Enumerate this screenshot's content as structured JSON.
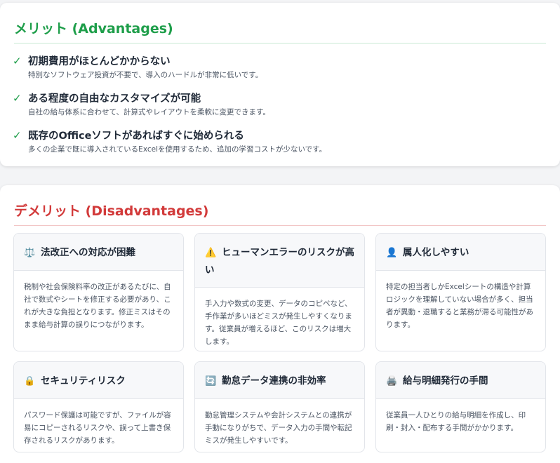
{
  "advantages": {
    "title": "メリット (Advantages)",
    "check_icon": "check-icon",
    "items": [
      {
        "heading": "初期費用がほとんどかからない",
        "desc": "特別なソフトウェア投資が不要で、導入のハードルが非常に低いです。"
      },
      {
        "heading": "ある程度の自由なカスタマイズが可能",
        "desc": "自社の給与体系に合わせて、計算式やレイアウトを柔軟に変更できます。"
      },
      {
        "heading": "既存のOfficeソフトがあればすぐに始められる",
        "desc": "多くの企業で既に導入されているExcelを使用するため、追加の学習コストが少ないです。"
      }
    ]
  },
  "disadvantages": {
    "title": "デメリット (Disadvantages)",
    "cards": [
      {
        "icon": "⚖️",
        "icon_name": "scales-icon",
        "heading": "法改正への対応が困難",
        "body": "税制や社会保険料率の改正があるたびに、自社で数式やシートを修正する必要があり、これが大きな負担となります。修正ミスはそのまま給与計算の誤りにつながります。"
      },
      {
        "icon": "⚠️",
        "icon_name": "warning-icon",
        "heading": "ヒューマンエラーのリスクが高い",
        "body": "手入力や数式の変更、データのコピペなど、手作業が多いほどミスが発生しやすくなります。従業員が増えるほど、このリスクは増大します。"
      },
      {
        "icon": "👤",
        "icon_name": "person-icon",
        "heading": "属人化しやすい",
        "body": "特定の担当者しかExcelシートの構造や計算ロジックを理解していない場合が多く、担当者が異動・退職すると業務が滞る可能性があります。"
      },
      {
        "icon": "🔒",
        "icon_name": "lock-icon",
        "heading": "セキュリティリスク",
        "body": "パスワード保護は可能ですが、ファイルが容易にコピーされるリスクや、誤って上書き保存されるリスクがあります。"
      },
      {
        "icon": "🔄",
        "icon_name": "sync-icon",
        "heading": "勤怠データ連携の非効率",
        "body": "勤怠管理システムや会計システムとの連携が手動になりがちで、データ入力の手間や転記ミスが発生しやすいです。"
      },
      {
        "icon": "🖨️",
        "icon_name": "printer-icon",
        "heading": "給与明細発行の手間",
        "body": "従業員一人ひとりの給与明細を作成し、印刷・封入・配布する手間がかかります。"
      }
    ]
  },
  "colors": {
    "advantage_green": "#1e9e4a",
    "disadvantage_red": "#d23a3a"
  }
}
